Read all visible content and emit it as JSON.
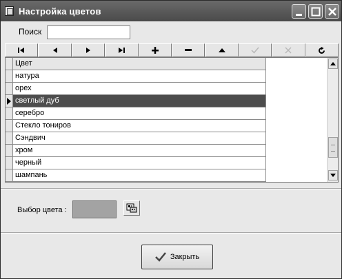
{
  "window": {
    "title": "Настройка цветов",
    "icon": "app-window-icon"
  },
  "search": {
    "label": "Поиск",
    "value": "",
    "placeholder": ""
  },
  "navigator": {
    "buttons": [
      {
        "name": "first-record-button",
        "icon": "first-icon"
      },
      {
        "name": "prior-record-button",
        "icon": "prior-icon"
      },
      {
        "name": "next-record-button",
        "icon": "next-icon"
      },
      {
        "name": "last-record-button",
        "icon": "last-icon"
      },
      {
        "name": "insert-record-button",
        "icon": "plus-icon"
      },
      {
        "name": "delete-record-button",
        "icon": "minus-icon"
      },
      {
        "name": "edit-record-button",
        "icon": "triangle-up-icon"
      },
      {
        "name": "post-record-button",
        "icon": "check-icon",
        "disabled": true
      },
      {
        "name": "cancel-record-button",
        "icon": "x-icon",
        "disabled": true
      },
      {
        "name": "refresh-records-button",
        "icon": "refresh-icon"
      }
    ]
  },
  "grid": {
    "column_header": "Цвет",
    "rows": [
      "натура",
      "орех",
      "светлый дуб",
      "серебро",
      "Стекло тониров",
      "Сэндвич",
      "хром",
      "черный",
      "шампань"
    ],
    "selected_index": 2
  },
  "color_picker": {
    "label": "Выбор цвета :",
    "swatch_color": "#a3a3a3"
  },
  "footer": {
    "close_label": "Закрыть"
  }
}
